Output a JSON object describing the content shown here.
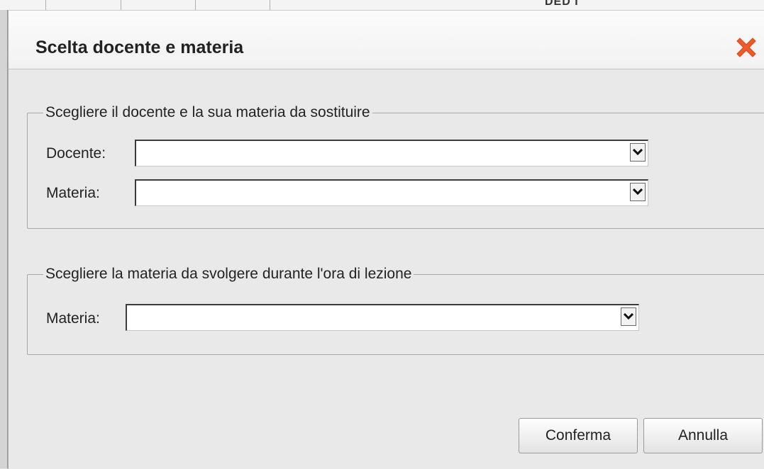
{
  "background": {
    "partial_text": "DED I"
  },
  "dialog": {
    "title": "Scelta docente e materia",
    "close_icon": "close-x-icon",
    "close_color": "#f05a28"
  },
  "group_substitute": {
    "legend": "Scegliere il docente e la sua materia da sostituire",
    "docente_label": "Docente:",
    "docente_value": "",
    "materia_label": "Materia:",
    "materia_value": ""
  },
  "group_lesson": {
    "legend": "Scegliere la materia da svolgere durante l'ora di lezione",
    "materia_label": "Materia:",
    "materia_value": ""
  },
  "buttons": {
    "confirm": "Conferma",
    "cancel": "Annulla"
  }
}
